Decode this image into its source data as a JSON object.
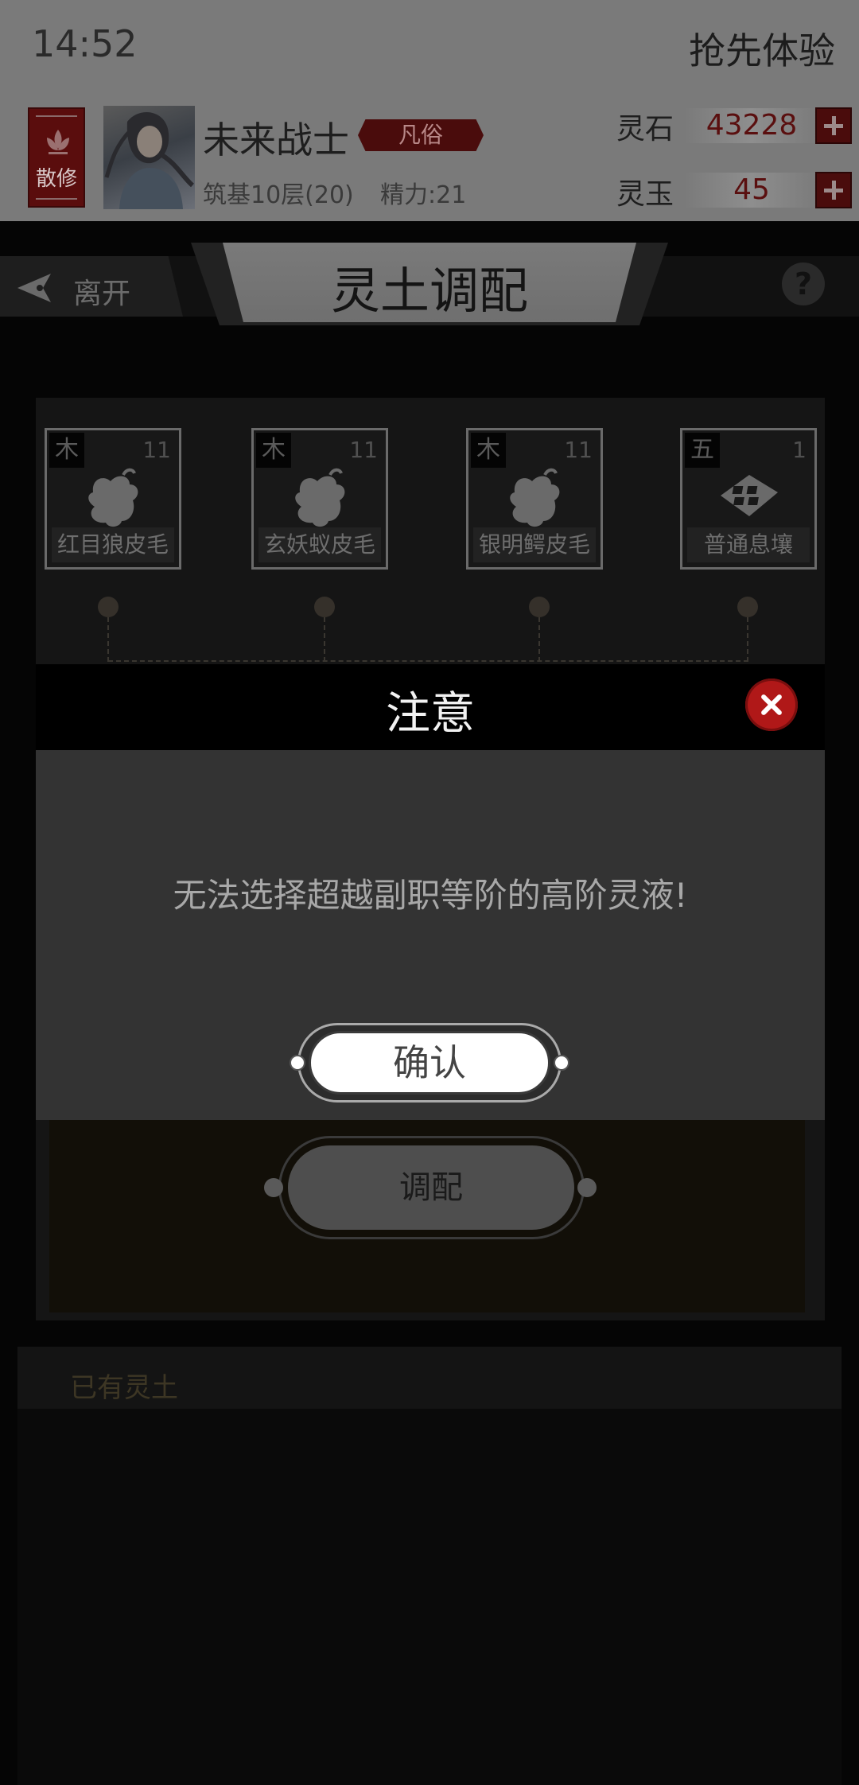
{
  "status": {
    "time": "14:52",
    "right_text": "抢先体验"
  },
  "player": {
    "sect": "散修",
    "name": "未来战士",
    "rank": "凡俗",
    "cultivation": "筑基10层(20)",
    "energy": "精力:21"
  },
  "currencies": [
    {
      "label": "灵石",
      "value": "43228"
    },
    {
      "label": "灵玉",
      "value": "45"
    }
  ],
  "header": {
    "back_label": "离开",
    "title": "灵土调配",
    "help": "?"
  },
  "materials": [
    {
      "element": "木",
      "count": "11",
      "name": "红目狼皮毛",
      "icon": "fur-icon"
    },
    {
      "element": "木",
      "count": "11",
      "name": "玄妖蚁皮毛",
      "icon": "fur-icon"
    },
    {
      "element": "木",
      "count": "11",
      "name": "银明鳄皮毛",
      "icon": "fur-icon"
    },
    {
      "element": "五",
      "count": "1",
      "name": "普通息壤",
      "icon": "soil-icon"
    }
  ],
  "mix_button": "调配",
  "owned_section": {
    "label": "已有灵土"
  },
  "modal": {
    "title": "注意",
    "message": "无法选择超越副职等阶的高阶灵液!",
    "confirm_label": "确认"
  }
}
